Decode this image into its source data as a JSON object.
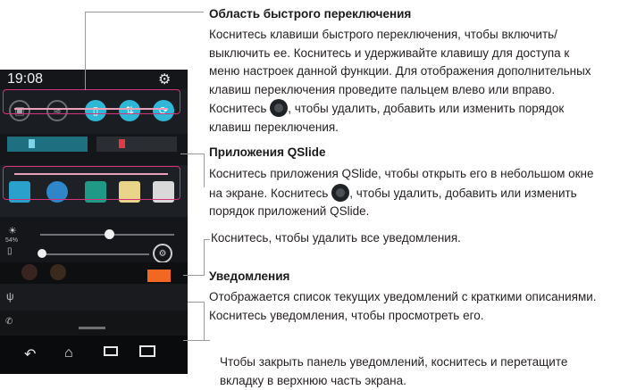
{
  "phone": {
    "time": "19:08",
    "gear_icon": "gear-icon",
    "quick_settings": [
      "screenshot-icon",
      "wifi-icon",
      "vibrate-icon",
      "data-sync-icon",
      "rotate-icon"
    ],
    "brightness_label": "54%",
    "apps": [
      "video-app-icon",
      "browser-app-icon",
      "phone-app-icon",
      "memo-app-icon",
      "calendar-app-icon"
    ],
    "nav_buttons": [
      "back-icon",
      "home-icon",
      "recent-apps-icon",
      "dual-window-icon"
    ],
    "colors": {
      "accent": "#2fb8d6",
      "highlight": "#d7337a",
      "orange": "#f26722"
    }
  },
  "sections": {
    "quick_toggle": {
      "title": "Область быстрого переключения",
      "lines": [
        "Коснитесь клавиши быстрого переключения, чтобы включить/",
        "выключить ее. Коснитесь и удерживайте клавишу для доступа к",
        "меню настроек данной функции. Для отображения дополнительных",
        "клавиш переключения проведите пальцем влево или вправо."
      ],
      "line5_before": "Коснитесь ",
      "line5_after": ", чтобы удалить, добавить или изменить порядок",
      "line6": "клавиш переключения."
    },
    "qslide": {
      "title": "Приложения QSlide",
      "line1": "Коснитесь приложения QSlide, чтобы открыть его в небольшом окне",
      "line2_before": "на экране. Коснитесь ",
      "line2_after": ", чтобы удалить, добавить или изменить",
      "line3": "порядок приложений QSlide."
    },
    "clear_all": {
      "text": "Коснитесь, чтобы удалить все уведомления."
    },
    "notifications": {
      "title": "Уведомления",
      "line1": "Отображается список текущих уведомлений с краткими описаниями.",
      "line2": "Коснитесь уведомления, чтобы просмотреть его."
    },
    "close_panel": {
      "line1": "Чтобы закрыть панель уведомлений, коснитесь и перетащите",
      "line2": "вкладку в верхнюю часть экрана."
    }
  }
}
